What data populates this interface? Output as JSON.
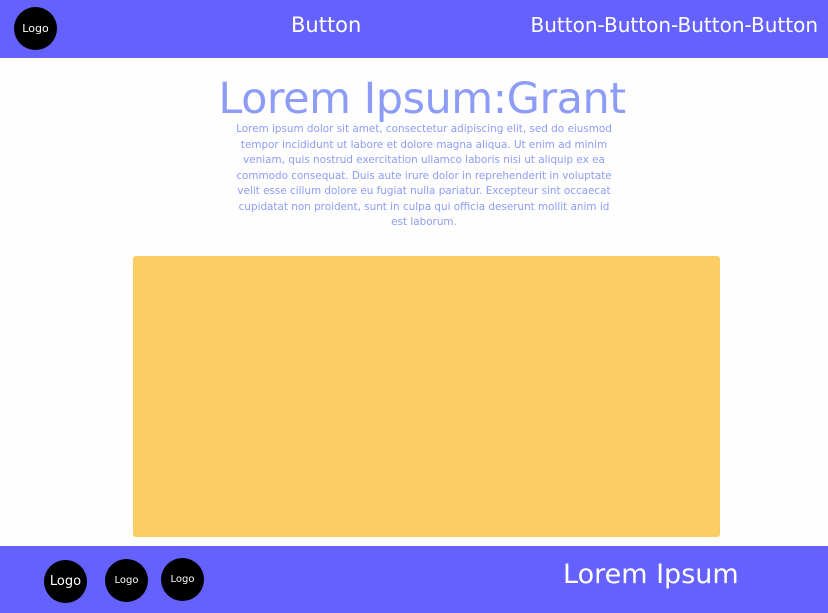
{
  "header": {
    "logo_label": "Logo",
    "button_label": "Button",
    "multi_button_label": "Button-Button-Button-Button"
  },
  "hero": {
    "title": "Lorem Ipsum:Grant",
    "body": "Lorem ipsum dolor sit amet, consectetur adipiscing elit, sed do eiusmod tempor incididunt ut labore et dolore magna aliqua. Ut enim ad minim veniam, quis nostrud exercitation ullamco laboris nisi ut aliquip ex ea commodo consequat. Duis aute irure dolor in reprehenderit in voluptate velit esse cillum dolore eu fugiat nulla pariatur. Excepteur sint occaecat cupidatat non proident, sunt in culpa qui officia deserunt mollit anim id est laborum."
  },
  "footer": {
    "logos": [
      "Logo",
      "Logo",
      "Logo"
    ],
    "text": "Lorem Ipsum"
  },
  "colors": {
    "bar": "#6561fe",
    "text_accent": "#8d9cf6",
    "image_placeholder": "#fbcd65",
    "logo_bg": "#000000",
    "background": "#fefefe"
  }
}
